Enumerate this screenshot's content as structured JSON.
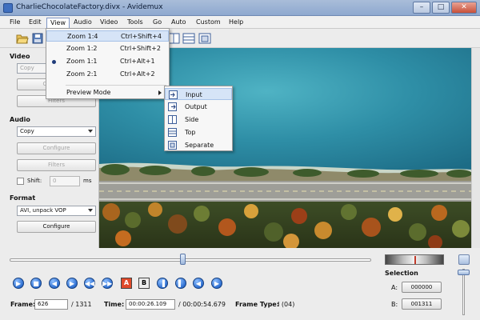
{
  "window": {
    "title": "CharlieChocolateFactory.divx - Avidemux",
    "minimize_label": "–",
    "maximize_label": "□",
    "close_label": "✕"
  },
  "menubar": [
    "File",
    "Edit",
    "View",
    "Audio",
    "Video",
    "Tools",
    "Go",
    "Auto",
    "Custom",
    "Help"
  ],
  "view_menu": {
    "items": [
      {
        "label": "Zoom 1:4",
        "accel": "Ctrl+Shift+4",
        "highlighted": true
      },
      {
        "label": "Zoom 1:2",
        "accel": "Ctrl+Shift+2"
      },
      {
        "label": "Zoom 1:1",
        "accel": "Ctrl+Alt+1",
        "checked": true
      },
      {
        "label": "Zoom 2:1",
        "accel": "Ctrl+Alt+2"
      }
    ],
    "preview_mode": "Preview Mode",
    "submenu": [
      {
        "label": "Input",
        "highlighted": true
      },
      {
        "label": "Output"
      },
      {
        "label": "Side"
      },
      {
        "label": "Top"
      },
      {
        "label": "Separate"
      }
    ]
  },
  "left_panel": {
    "video": {
      "label": "Video",
      "codec": "Copy",
      "configure": "Configure",
      "filters": "Filters"
    },
    "audio": {
      "label": "Audio",
      "codec": "Copy",
      "configure": "Configure",
      "filters": "Filters",
      "shift_label": "Shift:",
      "shift_value": "0",
      "shift_unit": "ms"
    },
    "format": {
      "label": "Format",
      "container": "AVI, unpack VOP",
      "configure": "Configure"
    }
  },
  "transport": {
    "a_label": "A",
    "b_label": "B",
    "frame_label": "Frame:",
    "frame_value": "626",
    "frame_total": "/ 1311",
    "time_label": "Time:",
    "time_value": "00:00:26.109",
    "time_total": "/ 00:00:54.679",
    "frame_type_label": "Frame Type:",
    "frame_type_value": "I (04)",
    "seek_position": 0.478
  },
  "selection": {
    "title": "Selection",
    "a_label": "A:",
    "a_value": "000000",
    "b_label": "B:",
    "b_value": "001311"
  }
}
